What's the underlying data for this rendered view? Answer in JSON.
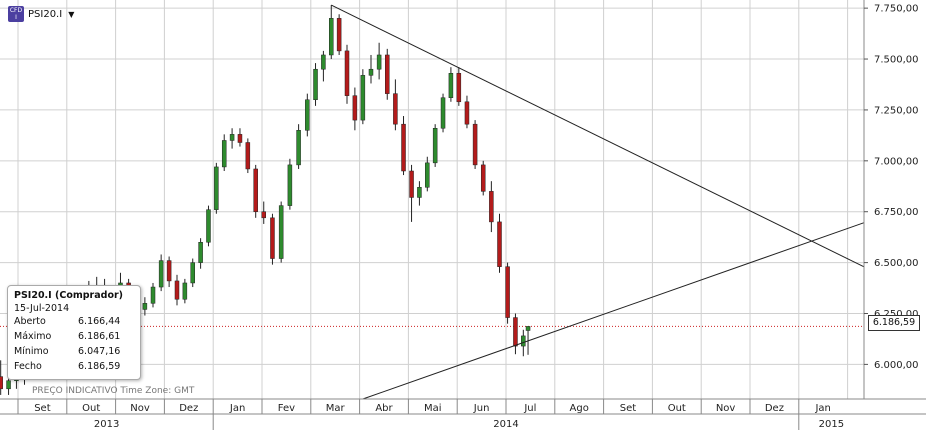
{
  "header": {
    "icon": "cfd-index-icon",
    "icon_text_top": "CFD",
    "icon_text_bottom": "I",
    "symbol": "PSI20.I",
    "dropdown_icon": "caret-down-icon"
  },
  "tooltip": {
    "title": "PSI20.I (Comprador)",
    "date": "15-Jul-2014",
    "rows": [
      {
        "label": "Aberto",
        "value": "6.166,44"
      },
      {
        "label": "Máximo",
        "value": "6.186,61"
      },
      {
        "label": "Mínimo",
        "value": "6.047,16"
      },
      {
        "label": "Fecho",
        "value": "6.186,59"
      }
    ]
  },
  "footer_note": "PREÇO INDICATIVO   Time Zone: GMT",
  "last_price_label": "6.186,59",
  "colors": {
    "up": "#2e8b2e",
    "down": "#b31b1b",
    "grid": "#d0d0d0",
    "trendline": "#222222",
    "last_price_line": "#cc2222"
  },
  "chart_data": {
    "type": "candlestick",
    "title": "",
    "ylim": [
      5830,
      7790
    ],
    "y_ticks": [
      "6.000,00",
      "6.250,00",
      "6.500,00",
      "6.750,00",
      "7.000,00",
      "7.250,00",
      "7.500,00",
      "7.750,00"
    ],
    "y_tick_values": [
      6000,
      6250,
      6500,
      6750,
      7000,
      7250,
      7500,
      7750
    ],
    "x_months": [
      "Set",
      "Out",
      "Nov",
      "Dez",
      "Jan",
      "Fev",
      "Mar",
      "Abr",
      "Mai",
      "Jun",
      "Jul",
      "Ago",
      "Set",
      "Out",
      "Nov",
      "Dez",
      "Jan"
    ],
    "x_years": [
      "2013",
      "2014",
      "2015"
    ],
    "grid": true,
    "last_price": 6186.59,
    "trendlines": [
      {
        "from": [
          "2014-03-14",
          7765
        ],
        "to": [
          "2015-02-15",
          6460
        ]
      },
      {
        "from": [
          "2014-04-03",
          5830
        ],
        "to": [
          "2015-02-15",
          6710
        ]
      }
    ],
    "candles": [
      {
        "date": "2013-08-21",
        "o": 5940,
        "h": 6020,
        "l": 5850,
        "c": 5880
      },
      {
        "date": "2013-08-26",
        "o": 5880,
        "h": 5960,
        "l": 5850,
        "c": 5920
      },
      {
        "date": "2013-08-31",
        "o": 5920,
        "h": 5990,
        "l": 5880,
        "c": 5960
      },
      {
        "date": "2013-09-05",
        "o": 5960,
        "h": 6010,
        "l": 5900,
        "c": 5950
      },
      {
        "date": "2013-09-10",
        "o": 5950,
        "h": 6050,
        "l": 5930,
        "c": 6030
      },
      {
        "date": "2013-09-15",
        "o": 6030,
        "h": 6110,
        "l": 6000,
        "c": 6080
      },
      {
        "date": "2013-09-20",
        "o": 6080,
        "h": 6180,
        "l": 6050,
        "c": 6150
      },
      {
        "date": "2013-09-25",
        "o": 6150,
        "h": 6230,
        "l": 6110,
        "c": 6190
      },
      {
        "date": "2013-09-30",
        "o": 6190,
        "h": 6260,
        "l": 6120,
        "c": 6160
      },
      {
        "date": "2013-10-05",
        "o": 6160,
        "h": 6260,
        "l": 6140,
        "c": 6240
      },
      {
        "date": "2013-10-10",
        "o": 6240,
        "h": 6330,
        "l": 6220,
        "c": 6310
      },
      {
        "date": "2013-10-15",
        "o": 6310,
        "h": 6410,
        "l": 6290,
        "c": 6370
      },
      {
        "date": "2013-10-20",
        "o": 6370,
        "h": 6430,
        "l": 6330,
        "c": 6360
      },
      {
        "date": "2013-10-25",
        "o": 6360,
        "h": 6420,
        "l": 6300,
        "c": 6330
      },
      {
        "date": "2013-10-30",
        "o": 6330,
        "h": 6390,
        "l": 6290,
        "c": 6370
      },
      {
        "date": "2013-11-04",
        "o": 6370,
        "h": 6450,
        "l": 6340,
        "c": 6400
      },
      {
        "date": "2013-11-09",
        "o": 6400,
        "h": 6420,
        "l": 6300,
        "c": 6320
      },
      {
        "date": "2013-11-14",
        "o": 6320,
        "h": 6360,
        "l": 6250,
        "c": 6270
      },
      {
        "date": "2013-11-19",
        "o": 6270,
        "h": 6330,
        "l": 6240,
        "c": 6300
      },
      {
        "date": "2013-11-24",
        "o": 6300,
        "h": 6400,
        "l": 6280,
        "c": 6380
      },
      {
        "date": "2013-11-29",
        "o": 6380,
        "h": 6540,
        "l": 6360,
        "c": 6510
      },
      {
        "date": "2013-12-04",
        "o": 6510,
        "h": 6530,
        "l": 6380,
        "c": 6410
      },
      {
        "date": "2013-12-09",
        "o": 6410,
        "h": 6440,
        "l": 6290,
        "c": 6320
      },
      {
        "date": "2013-12-14",
        "o": 6320,
        "h": 6420,
        "l": 6300,
        "c": 6400
      },
      {
        "date": "2013-12-19",
        "o": 6400,
        "h": 6520,
        "l": 6380,
        "c": 6500
      },
      {
        "date": "2013-12-24",
        "o": 6500,
        "h": 6620,
        "l": 6470,
        "c": 6600
      },
      {
        "date": "2013-12-29",
        "o": 6600,
        "h": 6780,
        "l": 6580,
        "c": 6760
      },
      {
        "date": "2014-01-03",
        "o": 6760,
        "h": 6990,
        "l": 6740,
        "c": 6970
      },
      {
        "date": "2014-01-08",
        "o": 6970,
        "h": 7130,
        "l": 6950,
        "c": 7100
      },
      {
        "date": "2014-01-13",
        "o": 7100,
        "h": 7160,
        "l": 7060,
        "c": 7130
      },
      {
        "date": "2014-01-18",
        "o": 7130,
        "h": 7160,
        "l": 7070,
        "c": 7090
      },
      {
        "date": "2014-01-23",
        "o": 7090,
        "h": 7110,
        "l": 6940,
        "c": 6960
      },
      {
        "date": "2014-01-28",
        "o": 6960,
        "h": 6980,
        "l": 6720,
        "c": 6750
      },
      {
        "date": "2014-02-02",
        "o": 6750,
        "h": 6800,
        "l": 6690,
        "c": 6720
      },
      {
        "date": "2014-02-07",
        "o": 6720,
        "h": 6740,
        "l": 6490,
        "c": 6520
      },
      {
        "date": "2014-02-12",
        "o": 6520,
        "h": 6800,
        "l": 6500,
        "c": 6780
      },
      {
        "date": "2014-02-17",
        "o": 6780,
        "h": 7010,
        "l": 6760,
        "c": 6980
      },
      {
        "date": "2014-02-22",
        "o": 6980,
        "h": 7180,
        "l": 6960,
        "c": 7150
      },
      {
        "date": "2014-02-27",
        "o": 7150,
        "h": 7330,
        "l": 7120,
        "c": 7300
      },
      {
        "date": "2014-03-04",
        "o": 7300,
        "h": 7480,
        "l": 7270,
        "c": 7450
      },
      {
        "date": "2014-03-09",
        "o": 7450,
        "h": 7540,
        "l": 7390,
        "c": 7520
      },
      {
        "date": "2014-03-14",
        "o": 7520,
        "h": 7765,
        "l": 7500,
        "c": 7700
      },
      {
        "date": "2014-03-19",
        "o": 7700,
        "h": 7720,
        "l": 7520,
        "c": 7540
      },
      {
        "date": "2014-03-24",
        "o": 7540,
        "h": 7570,
        "l": 7280,
        "c": 7320
      },
      {
        "date": "2014-03-29",
        "o": 7320,
        "h": 7360,
        "l": 7150,
        "c": 7200
      },
      {
        "date": "2014-04-03",
        "o": 7200,
        "h": 7450,
        "l": 7180,
        "c": 7420
      },
      {
        "date": "2014-04-08",
        "o": 7420,
        "h": 7520,
        "l": 7380,
        "c": 7450
      },
      {
        "date": "2014-04-13",
        "o": 7450,
        "h": 7580,
        "l": 7400,
        "c": 7520
      },
      {
        "date": "2014-04-18",
        "o": 7520,
        "h": 7550,
        "l": 7300,
        "c": 7330
      },
      {
        "date": "2014-04-23",
        "o": 7330,
        "h": 7400,
        "l": 7150,
        "c": 7180
      },
      {
        "date": "2014-04-28",
        "o": 7180,
        "h": 7220,
        "l": 6930,
        "c": 6950
      },
      {
        "date": "2014-05-03",
        "o": 6950,
        "h": 6980,
        "l": 6700,
        "c": 6820
      },
      {
        "date": "2014-05-08",
        "o": 6820,
        "h": 6900,
        "l": 6780,
        "c": 6870
      },
      {
        "date": "2014-05-13",
        "o": 6870,
        "h": 7020,
        "l": 6850,
        "c": 6990
      },
      {
        "date": "2014-05-18",
        "o": 6990,
        "h": 7180,
        "l": 6970,
        "c": 7160
      },
      {
        "date": "2014-05-23",
        "o": 7160,
        "h": 7330,
        "l": 7140,
        "c": 7310
      },
      {
        "date": "2014-05-28",
        "o": 7310,
        "h": 7460,
        "l": 7290,
        "c": 7430
      },
      {
        "date": "2014-06-02",
        "o": 7430,
        "h": 7460,
        "l": 7270,
        "c": 7290
      },
      {
        "date": "2014-06-07",
        "o": 7290,
        "h": 7320,
        "l": 7160,
        "c": 7180
      },
      {
        "date": "2014-06-12",
        "o": 7180,
        "h": 7200,
        "l": 6960,
        "c": 6980
      },
      {
        "date": "2014-06-17",
        "o": 6980,
        "h": 7000,
        "l": 6830,
        "c": 6850
      },
      {
        "date": "2014-06-22",
        "o": 6850,
        "h": 6900,
        "l": 6650,
        "c": 6700
      },
      {
        "date": "2014-06-27",
        "o": 6700,
        "h": 6740,
        "l": 6450,
        "c": 6480
      },
      {
        "date": "2014-07-02",
        "o": 6480,
        "h": 6500,
        "l": 6200,
        "c": 6230
      },
      {
        "date": "2014-07-07",
        "o": 6230,
        "h": 6250,
        "l": 6050,
        "c": 6090
      },
      {
        "date": "2014-07-12",
        "o": 6090,
        "h": 6170,
        "l": 6040,
        "c": 6140
      },
      {
        "date": "2014-07-15",
        "o": 6166.44,
        "h": 6186.61,
        "l": 6047.16,
        "c": 6186.59
      }
    ]
  }
}
